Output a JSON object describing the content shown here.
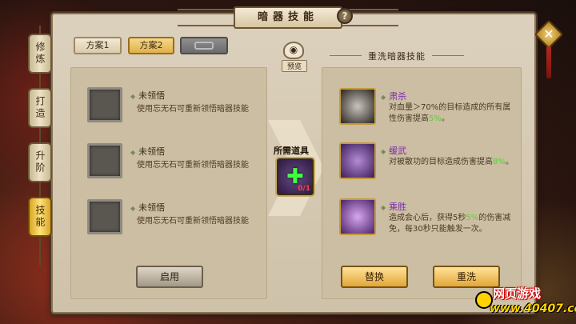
{
  "window": {
    "title": "暗器技能",
    "help": "?"
  },
  "side_tabs": [
    "修炼",
    "打造",
    "升阶",
    "技能"
  ],
  "scheme_tabs": {
    "tab1": "方案1",
    "tab2": "方案2"
  },
  "left": {
    "slots": [
      {
        "title": "未领悟",
        "desc": "使用忘无石可重新领悟暗器技能"
      },
      {
        "title": "未领悟",
        "desc": "使用忘无石可重新领悟暗器技能"
      },
      {
        "title": "未领悟",
        "desc": "使用忘无石可重新领悟暗器技能"
      }
    ],
    "enable_button": "启用"
  },
  "middle": {
    "preview_label": "预览",
    "need_label": "所需道具",
    "need_count": "0/1"
  },
  "right": {
    "section_title": "重洗暗器技能",
    "skills": [
      {
        "name": "肃杀",
        "desc_pre": "对血量＞70%的目标造成的所有属性伤害提高",
        "value": "5%",
        "desc_post": "。"
      },
      {
        "name": "缓武",
        "desc_pre": "对被散功的目标造成伤害提高",
        "value": "8%",
        "desc_post": "。"
      },
      {
        "name": "乘胜",
        "desc_pre": "造成会心后，获得5秒",
        "value": "5%",
        "desc_post": "的伤害减免，每30秒只能触发一次。"
      }
    ],
    "replace_button": "替换",
    "rewash_button": "重洗"
  },
  "logo": {
    "top": "网页游戏",
    "bottom": "www.40407.com"
  },
  "colors": {
    "accent_gold": "#e2a638",
    "skill_name": "#7c2bb3",
    "value_green": "#5ccf3a"
  }
}
